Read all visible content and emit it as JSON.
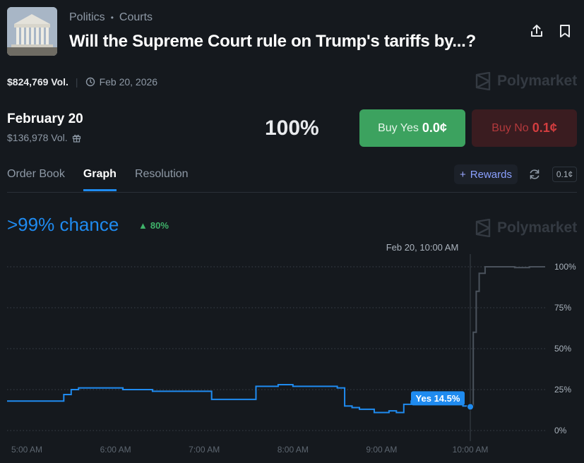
{
  "header": {
    "breadcrumb": [
      "Politics",
      "Courts"
    ],
    "title": "Will the Supreme Court rule on Trump's tariffs by...?",
    "total_volume": "$824,769 Vol.",
    "end_date": "Feb 20, 2026",
    "brand": "Polymarket"
  },
  "market": {
    "label": "February 20",
    "volume": "$136,978 Vol.",
    "probability": "100%",
    "buy_yes_label": "Buy Yes",
    "buy_yes_price": "0.0¢",
    "buy_no_label": "Buy No",
    "buy_no_price": "0.1¢"
  },
  "tabs": [
    {
      "label": "Order Book",
      "active": false
    },
    {
      "label": "Graph",
      "active": true
    },
    {
      "label": "Resolution",
      "active": false
    }
  ],
  "toolbar": {
    "rewards_label": "Rewards",
    "spread": "0.1¢"
  },
  "graph": {
    "chance": ">99% chance",
    "change": "80%",
    "hover_label": "Feb 20, 10:00 AM",
    "tooltip": "Yes 14.5%",
    "brand": "Polymarket"
  },
  "colors": {
    "accent": "#1f8bf0",
    "yes": "#3ca25f",
    "no": "#d33d3f",
    "background": "#15191e"
  },
  "chart_data": {
    "type": "line",
    "series": [
      {
        "name": "Yes",
        "x": [
          "5:00 AM",
          "5:05 AM",
          "5:10 AM",
          "5:15 AM",
          "5:20 AM",
          "5:25 AM",
          "5:30 AM",
          "5:35 AM",
          "5:40 AM",
          "5:45 AM",
          "5:50 AM",
          "5:55 AM",
          "6:00 AM",
          "6:05 AM",
          "6:10 AM",
          "6:15 AM",
          "6:20 AM",
          "6:25 AM",
          "6:30 AM",
          "6:35 AM",
          "6:40 AM",
          "6:45 AM",
          "6:50 AM",
          "6:55 AM",
          "7:00 AM",
          "7:05 AM",
          "7:10 AM",
          "7:15 AM",
          "7:20 AM",
          "7:25 AM",
          "7:30 AM",
          "7:35 AM",
          "7:40 AM",
          "7:45 AM",
          "7:50 AM",
          "7:55 AM",
          "8:00 AM",
          "8:05 AM",
          "8:10 AM",
          "8:15 AM",
          "8:20 AM",
          "8:25 AM",
          "8:30 AM",
          "8:35 AM",
          "8:40 AM",
          "8:45 AM",
          "8:50 AM",
          "8:55 AM",
          "9:00 AM",
          "9:05 AM",
          "9:10 AM",
          "9:15 AM",
          "9:20 AM",
          "9:25 AM",
          "9:30 AM",
          "9:35 AM",
          "9:40 AM",
          "9:45 AM",
          "9:50 AM",
          "9:55 AM",
          "10:00 AM",
          "10:02 AM",
          "10:04 AM",
          "10:06 AM",
          "10:10 AM",
          "10:20 AM",
          "10:30 AM",
          "10:40 AM",
          "10:50 AM"
        ],
        "values": [
          18,
          18,
          18,
          18,
          18,
          22,
          25,
          26,
          26,
          26,
          26,
          26,
          26,
          25,
          25,
          25,
          25,
          24,
          24,
          24,
          24,
          24,
          24,
          24,
          24,
          19,
          19,
          19,
          19,
          19,
          19,
          27,
          27,
          27,
          28,
          28,
          27,
          27,
          27,
          27,
          27,
          27,
          26,
          15,
          14,
          13,
          13,
          11,
          11,
          12,
          11,
          16,
          18,
          19,
          21,
          22,
          20,
          17,
          16,
          15,
          14.5,
          60,
          85,
          96,
          100,
          100,
          99.5,
          100,
          100
        ]
      }
    ],
    "x_ticks": [
      "5:00 AM",
      "6:00 AM",
      "7:00 AM",
      "8:00 AM",
      "9:00 AM",
      "10:00 AM"
    ],
    "y_ticks": [
      "0%",
      "25%",
      "50%",
      "75%",
      "100%"
    ],
    "ylim": [
      0,
      100
    ],
    "grid": true
  }
}
